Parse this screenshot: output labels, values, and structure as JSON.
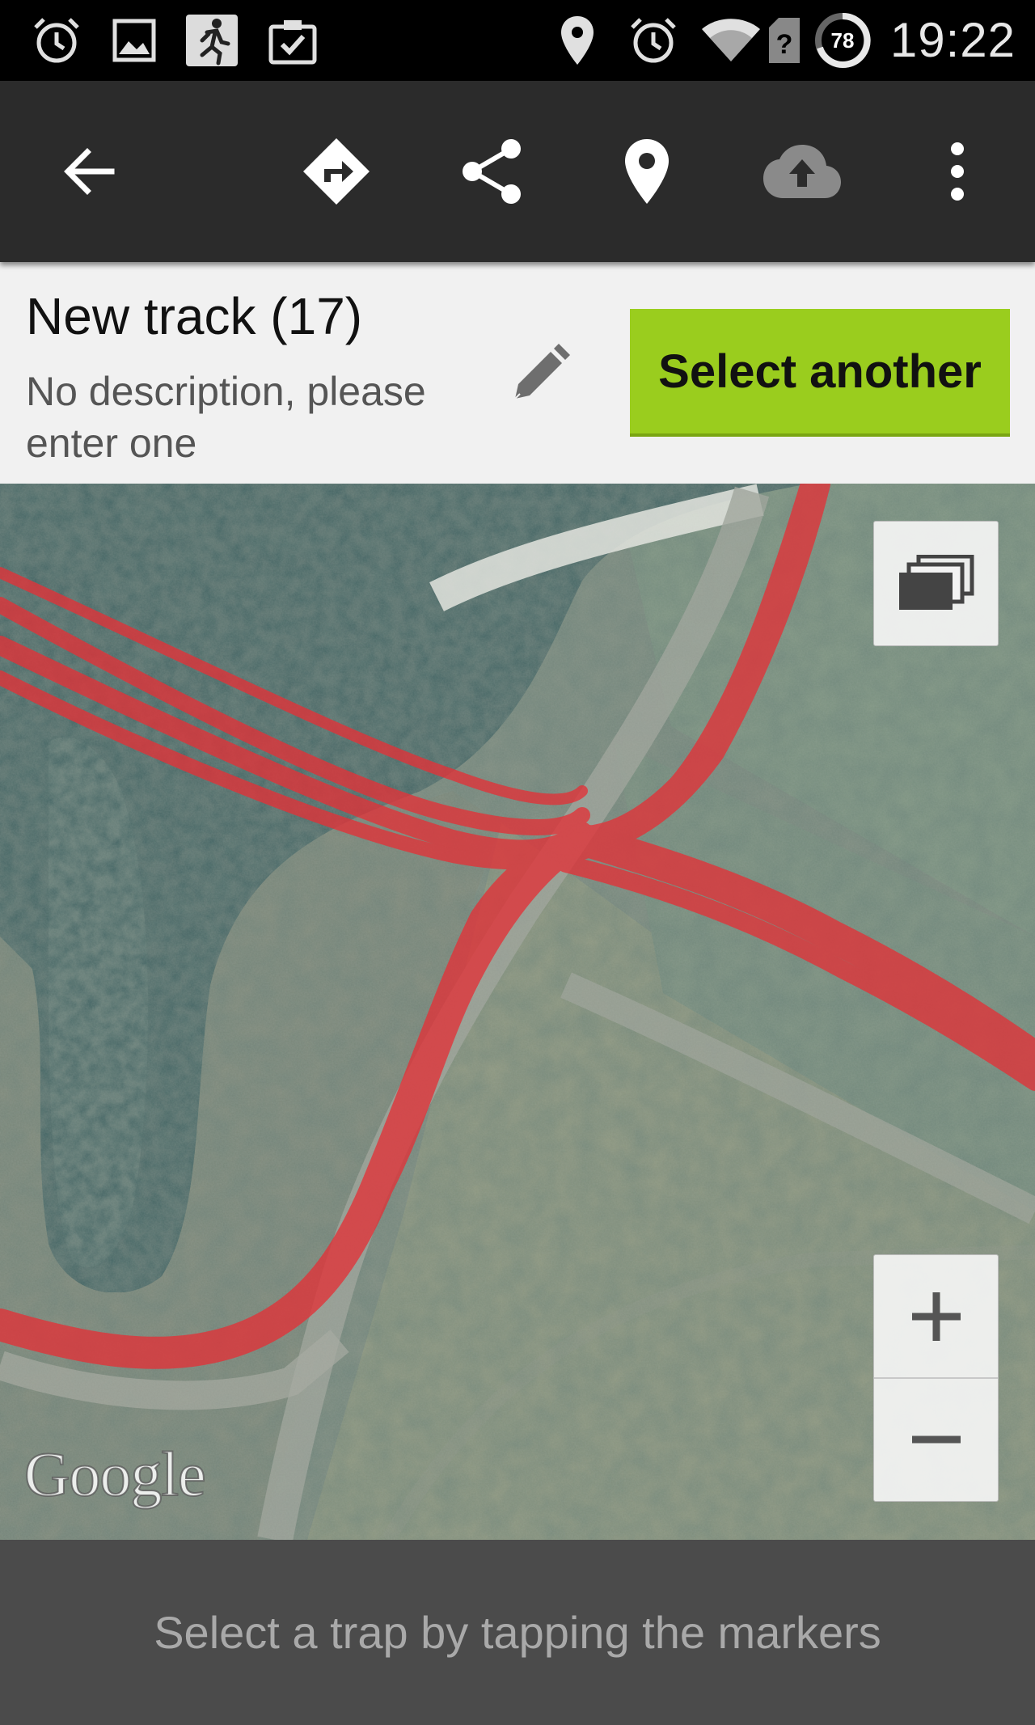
{
  "status_bar": {
    "time": "19:22",
    "battery_level": "78",
    "left_icons": [
      "alarm-icon",
      "image-icon",
      "running-app-icon",
      "clipboard-check-icon"
    ],
    "right_icons": [
      "location-pin-icon",
      "alarm-icon",
      "wifi-icon",
      "no-sim-icon",
      "battery-icon"
    ]
  },
  "action_bar": {
    "buttons": [
      "back-arrow-icon",
      "directions-icon",
      "share-icon",
      "place-icon",
      "cloud-upload-icon",
      "overflow-menu-icon"
    ]
  },
  "track": {
    "title": "New track (17)",
    "description": "No description, please enter one",
    "select_button_label": "Select another"
  },
  "map": {
    "type": "satellite",
    "attribution": "Google",
    "track_color": "#e8353a",
    "controls": [
      "layers-icon",
      "zoom-in-icon",
      "zoom-out-icon"
    ]
  },
  "hint": {
    "text": "Select a trap by tapping the markers"
  },
  "colors": {
    "accent_button": "#9acd1e",
    "action_bar": "#2b2b2b",
    "status_bar": "#000000",
    "hint_bar": "#4b4b4b"
  }
}
